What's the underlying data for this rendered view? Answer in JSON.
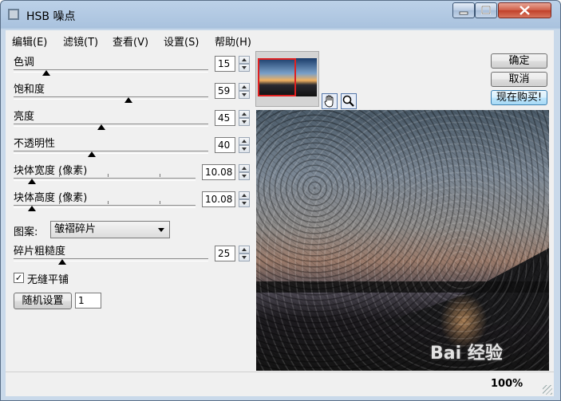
{
  "window": {
    "title": "HSB 噪点"
  },
  "menu": [
    "编辑(E)",
    "滤镜(T)",
    "查看(V)",
    "设置(S)",
    "帮助(H)"
  ],
  "params": [
    {
      "label": "色调",
      "value": "15",
      "level": 0.17
    },
    {
      "label": "饱和度",
      "value": "59",
      "level": 0.59
    },
    {
      "label": "亮度",
      "value": "45",
      "level": 0.45
    },
    {
      "label": "不透明性",
      "value": "40",
      "level": 0.4
    },
    {
      "label": "块体宽度 (像素)",
      "value": "10.08",
      "level": 0.1
    },
    {
      "label": "块体高度 (像素)",
      "value": "10.08",
      "level": 0.1
    }
  ],
  "pattern": {
    "label": "图案:",
    "value": "皱褶碎片"
  },
  "roughness": {
    "label": "碎片粗糙度",
    "value": "25",
    "level": 0.25
  },
  "seamless": {
    "label": "无缝平铺",
    "checked": true
  },
  "random": {
    "button": "随机设置",
    "value": "1"
  },
  "buttons": {
    "ok": "确定",
    "cancel": "取消",
    "buy": "现在购买!"
  },
  "status": {
    "zoom": "100%"
  },
  "watermark": "Bai 经验",
  "icons": {
    "hand": "hand-tool-icon",
    "zoom": "zoom-tool-icon"
  }
}
